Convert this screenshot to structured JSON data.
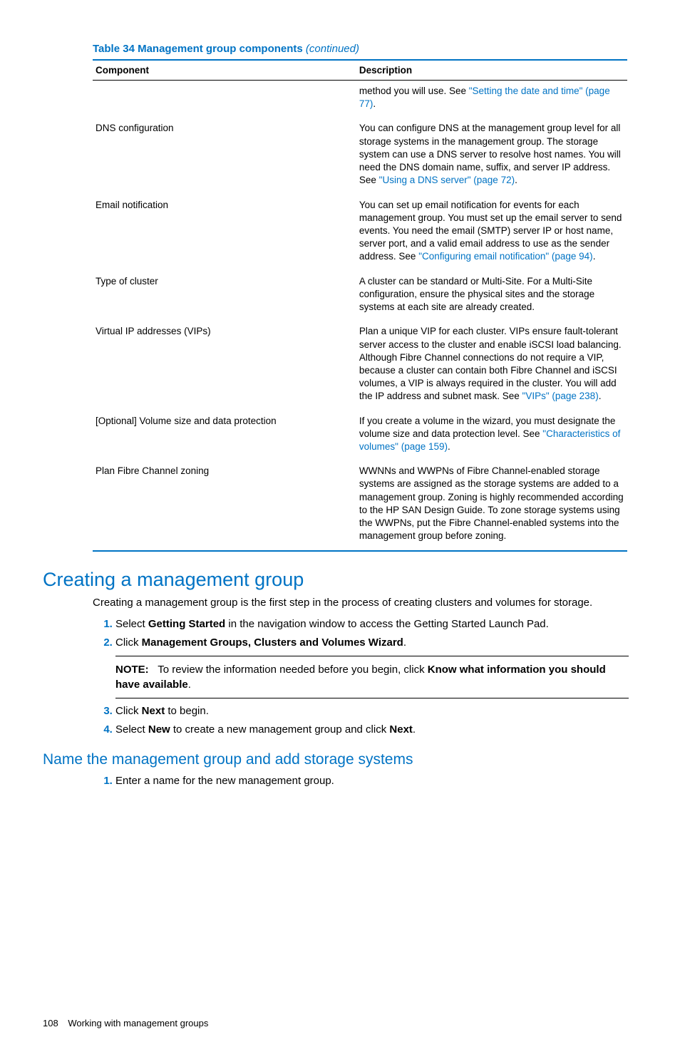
{
  "table": {
    "title_prefix": "Table 34 Management group components",
    "title_suffix": " (continued)",
    "headers": {
      "component": "Component",
      "description": "Description"
    },
    "rows": [
      {
        "component": "",
        "desc_before": "method you will use. See ",
        "link": "\"Setting the date and time\" (page 77)",
        "desc_after": "."
      },
      {
        "component": "DNS configuration",
        "desc_before": "You can configure DNS at the management group level for all storage systems in the management group. The storage system can use a DNS server to resolve host names. You will need the DNS domain name, suffix, and server IP address. See ",
        "link": "\"Using a DNS server\" (page 72)",
        "desc_after": "."
      },
      {
        "component": "Email notification",
        "desc_before": "You can set up email notification for events for each management group. You must set up the email server to send events. You need the email (SMTP) server IP or host name, server port, and a valid email address to use as the sender address. See ",
        "link": "\"Configuring email notification\" (page 94)",
        "desc_after": "."
      },
      {
        "component": "Type of cluster",
        "desc_before": "A cluster can be standard or Multi-Site. For a Multi-Site configuration, ensure the physical sites and the storage systems at each site are already created.",
        "link": "",
        "desc_after": ""
      },
      {
        "component": "Virtual IP addresses (VIPs)",
        "desc_before": "Plan a unique VIP for each cluster. VIPs ensure fault-tolerant server access to the cluster and enable iSCSI load balancing.\nAlthough Fibre Channel connections do not require a VIP, because a cluster can contain both Fibre Channel and iSCSI volumes, a VIP is always required in the cluster. You will add the IP address and subnet mask. See ",
        "link": "\"VIPs\" (page 238)",
        "desc_after": "."
      },
      {
        "component": "[Optional] Volume size and data protection",
        "desc_before": "If you create a volume in the wizard, you must designate the volume size and data protection level. See ",
        "link": "\"Characteristics of volumes\" (page 159)",
        "desc_after": "."
      },
      {
        "component": "Plan Fibre Channel zoning",
        "desc_before": "WWNNs and WWPNs of Fibre Channel-enabled storage systems are assigned as the storage systems are added to a management group. Zoning is highly recommended according to the HP SAN Design Guide. To zone storage systems using the WWPNs, put the Fibre Channel-enabled systems into the management group before zoning.",
        "link": "",
        "desc_after": ""
      }
    ]
  },
  "section1": {
    "heading": "Creating a management group",
    "intro": "Creating a management group is the first step in the process of creating clusters and volumes for storage.",
    "step1_a": "Select ",
    "step1_b": "Getting Started",
    "step1_c": " in the navigation window to access the Getting Started Launch Pad.",
    "step2_a": "Click ",
    "step2_b": "Management Groups, Clusters and Volumes Wizard",
    "step2_c": ".",
    "note_label": "NOTE:",
    "note_a": "To review the information needed before you begin, click ",
    "note_b": "Know what information you should have available",
    "note_c": ".",
    "step3_a": "Click ",
    "step3_b": "Next",
    "step3_c": " to begin.",
    "step4_a": "Select ",
    "step4_b": "New",
    "step4_c": " to create a new management group and click ",
    "step4_d": "Next",
    "step4_e": "."
  },
  "section2": {
    "heading": "Name the management group and add storage systems",
    "step1": "Enter a name for the new management group."
  },
  "footer": {
    "page": "108",
    "chapter": "Working with management groups"
  }
}
